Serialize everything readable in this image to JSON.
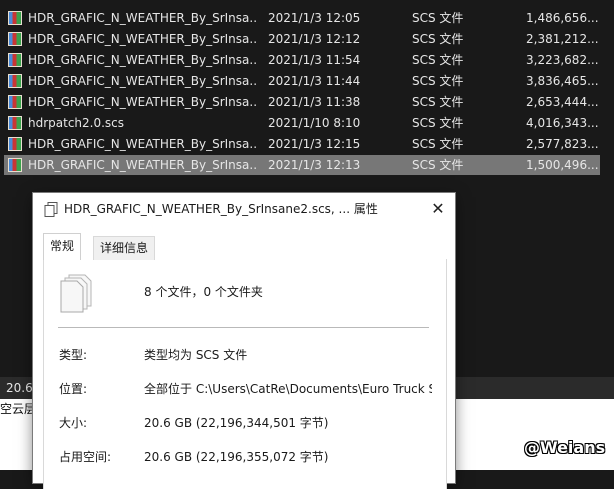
{
  "files": [
    {
      "name": "HDR_GRAFIC_N_WEATHER_By_SrInsa...",
      "date": "2021/1/3 12:05",
      "type": "SCS 文件",
      "size": "1,486,656...",
      "selected": false,
      "icon": "archive-icon"
    },
    {
      "name": "HDR_GRAFIC_N_WEATHER_By_SrInsa...",
      "date": "2021/1/3 12:12",
      "type": "SCS 文件",
      "size": "2,381,212...",
      "selected": false,
      "icon": "archive-icon"
    },
    {
      "name": "HDR_GRAFIC_N_WEATHER_By_SrInsa...",
      "date": "2021/1/3 11:54",
      "type": "SCS 文件",
      "size": "3,223,682...",
      "selected": false,
      "icon": "archive-icon"
    },
    {
      "name": "HDR_GRAFIC_N_WEATHER_By_SrInsa...",
      "date": "2021/1/3 11:44",
      "type": "SCS 文件",
      "size": "3,836,465...",
      "selected": false,
      "icon": "archive-icon"
    },
    {
      "name": "HDR_GRAFIC_N_WEATHER_By_SrInsa...",
      "date": "2021/1/3 11:38",
      "type": "SCS 文件",
      "size": "2,653,444...",
      "selected": false,
      "icon": "archive-icon"
    },
    {
      "name": "hdrpatch2.0.scs",
      "date": "2021/1/10 8:10",
      "type": "SCS 文件",
      "size": "4,016,343...",
      "selected": false,
      "icon": "file-icon"
    },
    {
      "name": "HDR_GRAFIC_N_WEATHER_By_SrInsa...",
      "date": "2021/1/3 12:15",
      "type": "SCS 文件",
      "size": "2,577,823...",
      "selected": false,
      "icon": "archive-icon"
    },
    {
      "name": "HDR_GRAFIC_N_WEATHER_By_SrInsa...",
      "date": "2021/1/3 12:13",
      "type": "SCS 文件",
      "size": "1,500,496...",
      "selected": true,
      "icon": "archive-icon"
    }
  ],
  "status": {
    "size_text": "20.6"
  },
  "background": {
    "cloud_label": "空云层",
    "watermark": "@Weians"
  },
  "dialog": {
    "title": "HDR_GRAFIC_N_WEATHER_By_SrInsane2.scs, ... 属性",
    "close_glyph": "✕",
    "tabs": [
      {
        "label": "常规",
        "active": true
      },
      {
        "label": "详细信息",
        "active": false
      }
    ],
    "summary": "8 个文件，0 个文件夹",
    "properties": [
      {
        "label": "类型:",
        "value": "类型均为 SCS 文件"
      },
      {
        "label": "位置:",
        "value": "全部位于 C:\\Users\\CatRe\\Documents\\Euro Truck S"
      },
      {
        "label": "大小:",
        "value": "20.6 GB (22,196,344,501 字节)"
      },
      {
        "label": "占用空间:",
        "value": "20.6 GB (22,196,355,072 字节)"
      }
    ]
  },
  "colors": {
    "explorer_bg": "#191919",
    "selected_row": "#777777",
    "dialog_bg": "#ffffff"
  }
}
